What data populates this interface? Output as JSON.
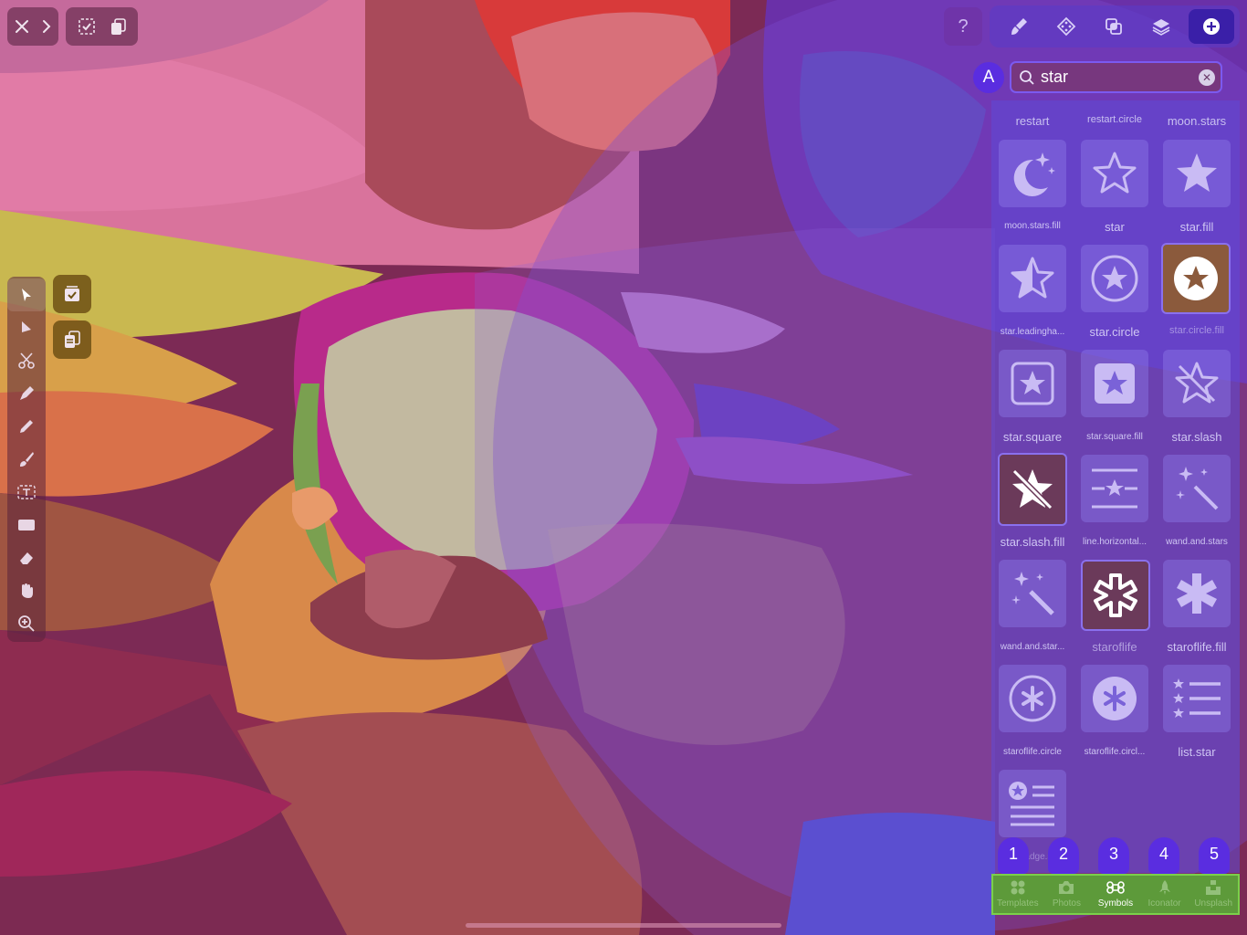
{
  "colors": {
    "accent": "#5a2de0",
    "panel": "#5f4bd7",
    "tabbar": "#5d9a3a"
  },
  "search": {
    "font_button_label": "A",
    "value": "star",
    "clear_icon": "xmark-circle-icon"
  },
  "header": {
    "help_label": "?"
  },
  "symbols": {
    "top_labels": [
      "restart",
      "restart.circle",
      "moon.stars"
    ],
    "items": [
      {
        "name": "moon.stars.fill",
        "icon": "moon-stars-fill-icon",
        "selected": false
      },
      {
        "name": "star",
        "icon": "star-icon",
        "selected": false
      },
      {
        "name": "star.fill",
        "icon": "star-fill-icon",
        "selected": false
      },
      {
        "name": "star.leadingha...",
        "icon": "star-leadinghalf-icon",
        "selected": false
      },
      {
        "name": "star.circle",
        "icon": "star-circle-icon",
        "selected": false
      },
      {
        "name": "star.circle.fill",
        "icon": "star-circle-fill-icon",
        "selected": true
      },
      {
        "name": "star.square",
        "icon": "star-square-icon",
        "selected": false
      },
      {
        "name": "star.square.fill",
        "icon": "star-square-fill-icon",
        "selected": false
      },
      {
        "name": "star.slash",
        "icon": "star-slash-icon",
        "selected": false
      },
      {
        "name": "star.slash.fill",
        "icon": "star-slash-fill-icon",
        "selected": true
      },
      {
        "name": "line.horizontal...",
        "icon": "line-horizontal-star-icon",
        "selected": false
      },
      {
        "name": "wand.and.stars",
        "icon": "wand-and-stars-icon",
        "selected": false
      },
      {
        "name": "wand.and.star...",
        "icon": "wand-and-stars-inverse-icon",
        "selected": false
      },
      {
        "name": "staroflife",
        "icon": "staroflife-icon",
        "selected": true
      },
      {
        "name": "staroflife.fill",
        "icon": "staroflife-fill-icon",
        "selected": false
      },
      {
        "name": "staroflife.circle",
        "icon": "staroflife-circle-icon",
        "selected": false
      },
      {
        "name": "staroflife.circl...",
        "icon": "staroflife-circle-fill-icon",
        "selected": false
      },
      {
        "name": "list.star",
        "icon": "list-star-icon",
        "selected": false
      },
      {
        "name": "text.badge.star",
        "icon": "text-badge-star-icon",
        "selected": false
      }
    ]
  },
  "badges": [
    "1",
    "2",
    "3",
    "4",
    "5"
  ],
  "tabs": [
    {
      "label": "Templates",
      "icon": "templates-icon",
      "active": false
    },
    {
      "label": "Photos",
      "icon": "camera-icon",
      "active": false
    },
    {
      "label": "Symbols",
      "icon": "command-icon",
      "active": true
    },
    {
      "label": "Iconator",
      "icon": "rocket-icon",
      "active": false
    },
    {
      "label": "Unsplash",
      "icon": "unsplash-icon",
      "active": false
    }
  ]
}
